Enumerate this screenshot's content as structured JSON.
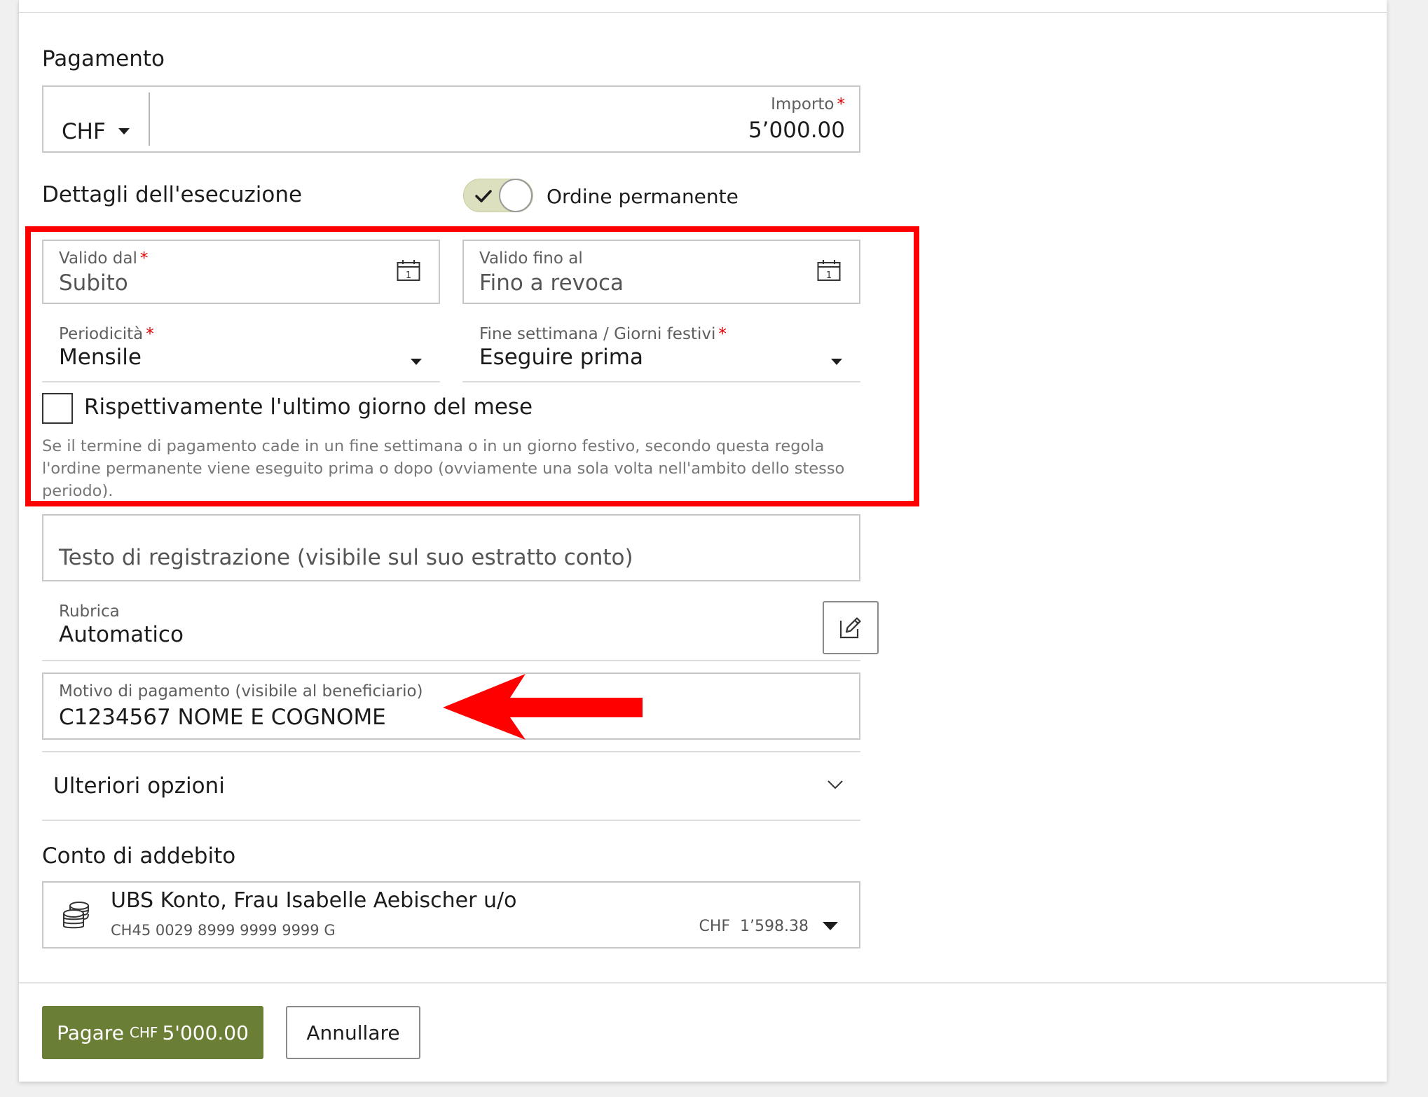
{
  "payment": {
    "section_title": "Pagamento",
    "currency": "CHF",
    "amount_label": "Importo",
    "amount_required": "*",
    "amount_value": "5’000.00"
  },
  "execution": {
    "section_title": "Dettagli dell'esecuzione",
    "standing_order_label": "Ordine permanente",
    "standing_order_on": true,
    "valid_from_label": "Valido dal",
    "valid_from_required": "*",
    "valid_from_value": "Subito",
    "valid_until_label": "Valido fino al",
    "valid_until_value": "Fino a revoca",
    "calendar_icon_digit": "1",
    "periodicity_label": "Periodicità",
    "periodicity_required": "*",
    "periodicity_value": "Mensile",
    "weekend_label": "Fine settimana / Giorni festivi",
    "weekend_required": "*",
    "weekend_value": "Eseguire prima",
    "last_day_checkbox_label": "Rispettivamente l'ultimo giorno del mese",
    "last_day_checked": false,
    "hint_line1": "Se il termine di pagamento cade in un fine settimana o in un giorno festivo, secondo questa regola",
    "hint_line2": "l'ordine permanente viene eseguito prima o dopo (ovviamente una sola volta nell'ambito dello stesso",
    "hint_line3": "periodo)."
  },
  "booking_text": {
    "placeholder": "Testo di registrazione (visibile sul suo estratto conto)"
  },
  "address_book": {
    "label": "Rubrica",
    "value": "Automatico"
  },
  "payment_reason": {
    "label": "Motivo di pagamento (visibile al beneficiario)",
    "value": "C1234567  NOME E COGNOME"
  },
  "more_options": {
    "label": "Ulteriori opzioni"
  },
  "debit_account": {
    "section_title": "Conto di addebito",
    "account_name": "UBS Konto, Frau Isabelle Aebischer u/o",
    "iban": "CH45 0029 8999 9999 9999 G",
    "balance_currency": "CHF",
    "balance_value": "1’598.38"
  },
  "actions": {
    "pay_label": "Pagare",
    "pay_currency": "CHF",
    "pay_amount": "5'000.00",
    "cancel_label": "Annullare"
  },
  "colors": {
    "highlight_red": "#ff0000",
    "primary_green": "#6b7e35",
    "toggle_track": "#dde0bf",
    "required_asterisk": "#e60000"
  },
  "icons": {
    "currency_dropdown": "caret-down-icon",
    "toggle_check": "check-icon",
    "calendar": "calendar-icon",
    "edit": "edit-icon",
    "expand": "chevron-down-icon",
    "account": "coins-icon",
    "annotation_arrow": "red-arrow-left"
  }
}
